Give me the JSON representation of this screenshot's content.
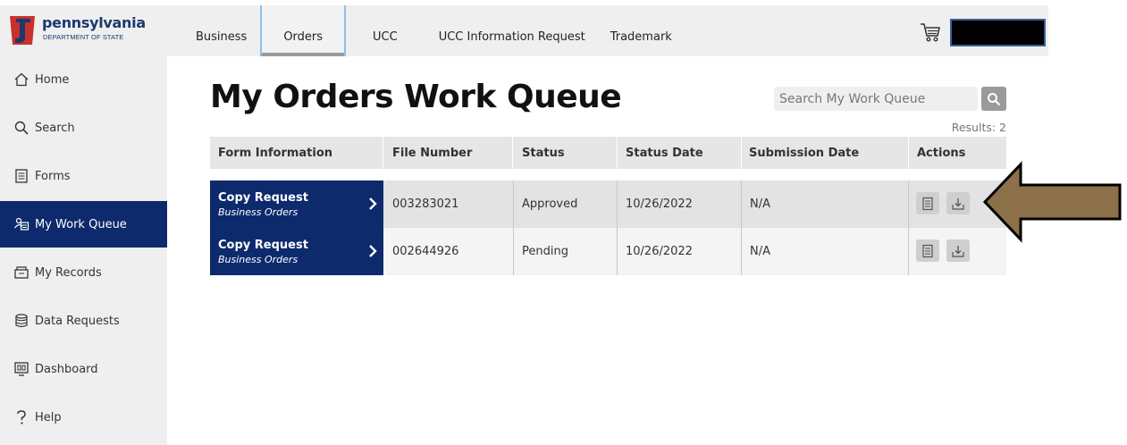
{
  "header": {
    "logo_title": "pennsylvania",
    "logo_subtitle": "DEPARTMENT OF STATE",
    "tabs": [
      {
        "label": "Business",
        "active": false
      },
      {
        "label": "Orders",
        "active": true
      },
      {
        "label": "UCC",
        "active": false
      },
      {
        "label": "UCC Information Request",
        "active": false
      },
      {
        "label": "Trademark",
        "active": false
      }
    ],
    "cart_icon": "cart-icon",
    "user_box_color": "#000000"
  },
  "sidebar": {
    "items": [
      {
        "label": "Home",
        "icon": "home-icon",
        "active": false
      },
      {
        "label": "Search",
        "icon": "search-icon",
        "active": false
      },
      {
        "label": "Forms",
        "icon": "forms-icon",
        "active": false
      },
      {
        "label": "My Work Queue",
        "icon": "work-queue-icon",
        "active": true
      },
      {
        "label": "My Records",
        "icon": "records-icon",
        "active": false
      },
      {
        "label": "Data Requests",
        "icon": "database-icon",
        "active": false
      },
      {
        "label": "Dashboard",
        "icon": "dashboard-icon",
        "active": false
      },
      {
        "label": "Help",
        "icon": "help-icon",
        "active": false
      }
    ]
  },
  "main": {
    "title": "My Orders Work Queue",
    "search_placeholder": "Search My Work Queue",
    "results": "Results: 2",
    "columns": [
      "Form Information",
      "File Number",
      "Status",
      "Status Date",
      "Submission Date",
      "Actions"
    ],
    "rows": [
      {
        "form_title": "Copy Request",
        "form_subtitle": "Business Orders",
        "file_number": "003283021",
        "status": "Approved",
        "status_date": "10/26/2022",
        "submission_date": "N/A"
      },
      {
        "form_title": "Copy Request",
        "form_subtitle": "Business Orders",
        "file_number": "002644926",
        "status": "Pending",
        "status_date": "10/26/2022",
        "submission_date": "N/A"
      }
    ]
  },
  "colors": {
    "primary_navy": "#0d2a6c",
    "annotation_arrow": "#8b7049"
  }
}
